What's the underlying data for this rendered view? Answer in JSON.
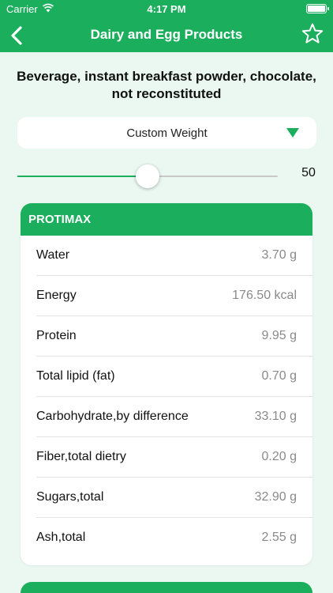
{
  "status": {
    "carrier": "Carrier",
    "time": "4:17 PM"
  },
  "nav": {
    "title": "Dairy and Egg Products"
  },
  "food": {
    "name": "Beverage, instant breakfast powder, chocolate, not reconstituted"
  },
  "weight": {
    "selected": "Custom Weight"
  },
  "slider": {
    "value": "50",
    "fraction": 0.5
  },
  "section": {
    "title": "PROTIMAX",
    "nutrients": [
      {
        "name": "Water",
        "value": "3.70 g"
      },
      {
        "name": "Energy",
        "value": "176.50 kcal"
      },
      {
        "name": "Protein",
        "value": "9.95 g"
      },
      {
        "name": "Total lipid (fat)",
        "value": "0.70 g"
      },
      {
        "name": "Carbohydrate,by difference",
        "value": "33.10 g"
      },
      {
        "name": "Fiber,total dietry",
        "value": "0.20 g"
      },
      {
        "name": "Sugars,total",
        "value": "32.90 g"
      },
      {
        "name": "Ash,total",
        "value": "2.55 g"
      }
    ]
  },
  "colors": {
    "accent": "#1bae5c",
    "background": "#eaf8f1"
  }
}
